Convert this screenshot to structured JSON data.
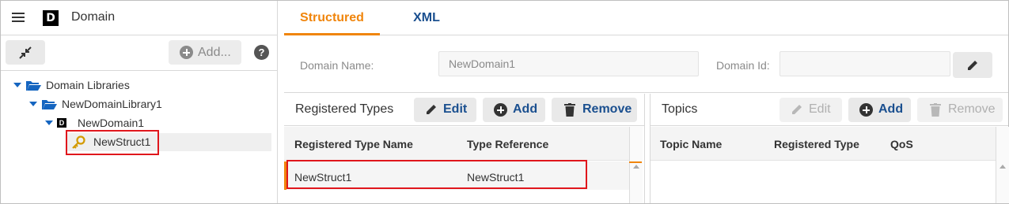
{
  "app": {
    "logo_letter": "D",
    "title": "Domain"
  },
  "left_toolbar": {
    "add_label": "Add...",
    "help_label": "?"
  },
  "tree": {
    "items": [
      {
        "label": "Domain Libraries",
        "type": "folder",
        "expanded": true,
        "level": 0
      },
      {
        "label": "NewDomainLibrary1",
        "type": "folder",
        "expanded": true,
        "level": 1
      },
      {
        "label": "NewDomain1",
        "type": "domain",
        "expanded": true,
        "level": 2
      },
      {
        "label": "NewStruct1",
        "type": "struct",
        "icon": "key-icon",
        "level": 3,
        "selected": true
      }
    ]
  },
  "tabs": [
    {
      "label": "Structured",
      "active": true
    },
    {
      "label": "XML",
      "active": false
    }
  ],
  "domain_form": {
    "name_label": "Domain Name:",
    "name_value": "NewDomain1",
    "id_label": "Domain Id:",
    "id_value": ""
  },
  "registered_types": {
    "title": "Registered Types",
    "buttons": {
      "edit": "Edit",
      "add": "Add",
      "remove": "Remove"
    },
    "columns": [
      "Registered Type Name",
      "Type Reference"
    ],
    "rows": [
      {
        "name": "NewStruct1",
        "reference": "NewStruct1"
      }
    ]
  },
  "topics": {
    "title": "Topics",
    "buttons": {
      "edit": "Edit",
      "add": "Add",
      "remove": "Remove"
    },
    "columns": [
      "Topic Name",
      "Registered Type",
      "QoS"
    ],
    "rows": []
  },
  "colors": {
    "accent_orange": "#f0850c",
    "link_blue": "#1a4f8f",
    "highlight_red": "#e0161c",
    "tree_blue": "#1565c0"
  }
}
